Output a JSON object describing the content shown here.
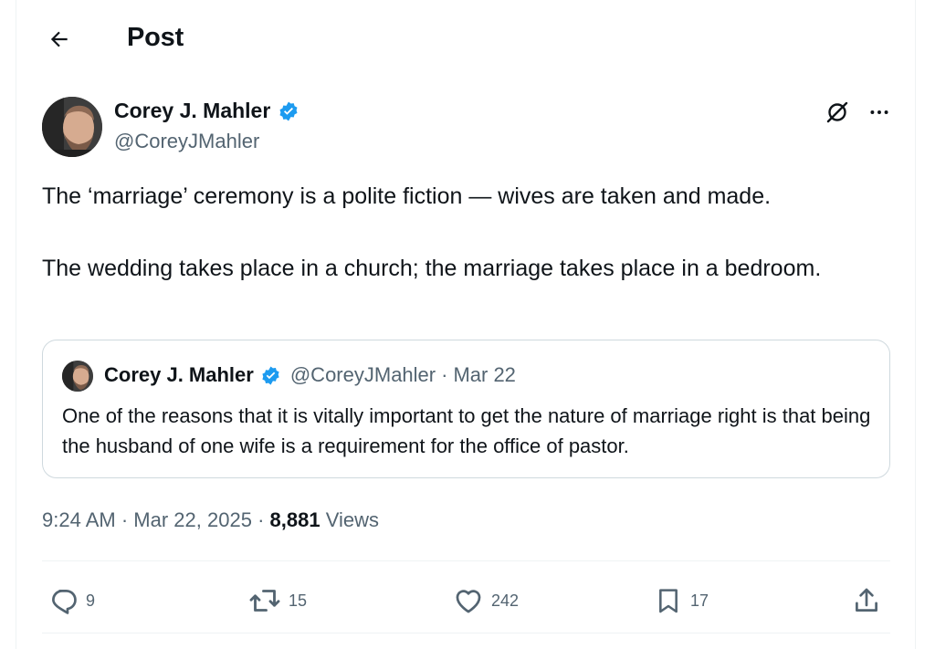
{
  "header": {
    "title": "Post"
  },
  "author": {
    "name": "Corey J. Mahler",
    "handle": "@CoreyJMahler"
  },
  "post": {
    "paragraphs": [
      "The ‘marriage’ ceremony is a polite fiction — wives are taken and made.",
      "The wedding takes place in a church; the marriage takes place in a bedroom."
    ],
    "time": "9:24 AM",
    "date": "Mar 22, 2025",
    "views_count": "8,881",
    "views_label": "Views"
  },
  "quote": {
    "name": "Corey J. Mahler",
    "handle": "@CoreyJMahler",
    "date": "Mar 22",
    "text": "One of the reasons that it is vitally important to get the nature of marriage right is that being the husband of one wife is a requirement for the office of pastor."
  },
  "actions": {
    "replies": "9",
    "reposts": "15",
    "likes": "242",
    "bookmarks": "17"
  },
  "colors": {
    "text": "#0f1419",
    "secondary": "#536471",
    "verified": "#1d9bf0",
    "border": "#cfd9de"
  }
}
